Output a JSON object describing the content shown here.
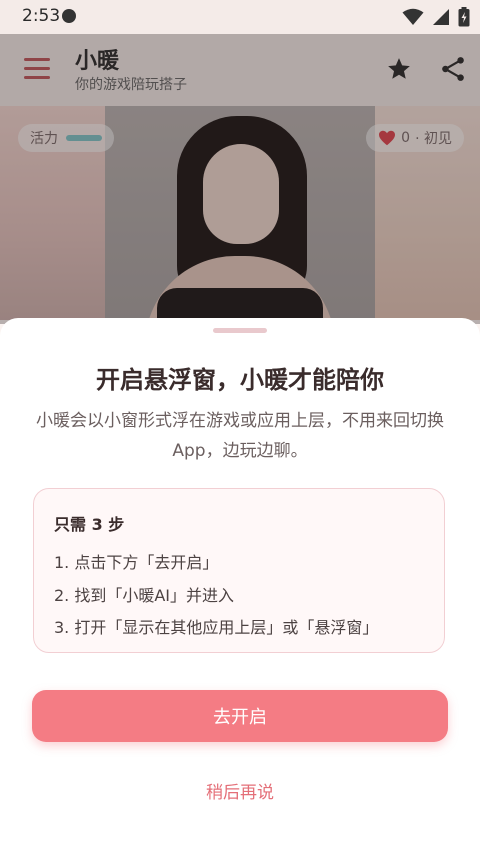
{
  "status_bar": {
    "time": "2:53"
  },
  "app_bar": {
    "title": "小暖",
    "subtitle": "你的游戏陪玩搭子",
    "menu_icon": "hamburger-menu-icon",
    "star_icon": "star-icon",
    "share_icon": "share-icon",
    "accent_color": "#c0565b"
  },
  "hero": {
    "vitality_label": "活力",
    "affection_count": "0",
    "affection_level": "· 初见"
  },
  "sheet": {
    "title": "开启悬浮窗，小暖才能陪你",
    "description": "小暖会以小窗形式浮在游戏或应用上层，不用来回切换 App，边玩边聊。",
    "steps_heading": "只需 3 步",
    "steps": [
      "1. 点击下方「去开启」",
      "2. 找到「小暖AI」并进入",
      "3. 打开「显示在其他应用上层」或「悬浮窗」"
    ],
    "primary_button": "去开启",
    "secondary_link": "稍后再说",
    "button_color": "#f47c84"
  }
}
